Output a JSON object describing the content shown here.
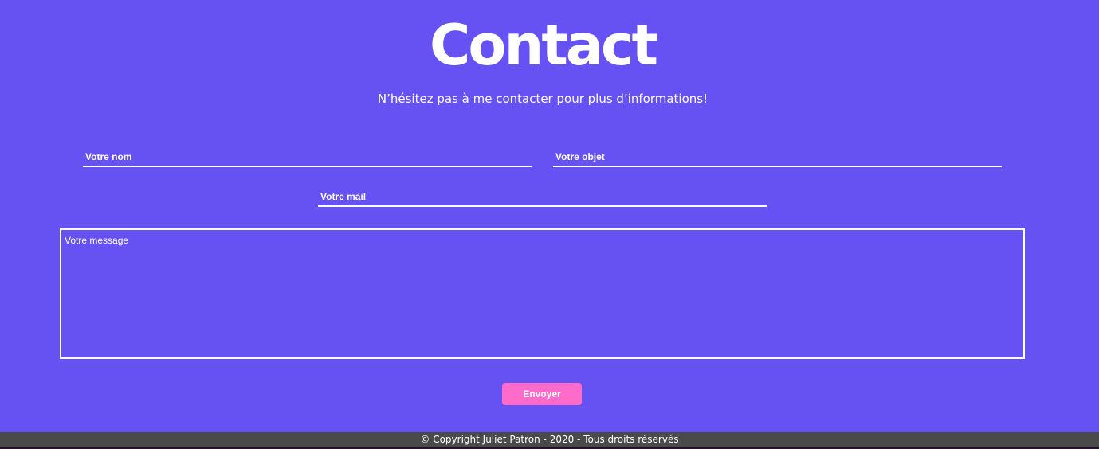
{
  "header": {
    "title": "Contact",
    "subtitle": "N’hésitez pas à me contacter pour plus d’informations!"
  },
  "form": {
    "name_placeholder": "Votre nom",
    "subject_placeholder": "Votre objet",
    "email_placeholder": "Votre mail",
    "message_placeholder": "Votre message",
    "submit_label": "Envoyer"
  },
  "footer": {
    "text": "© Copyright Juliet Patron - 2020 - Tous droits réservés"
  },
  "colors": {
    "background": "#6652f3",
    "button": "#ff6bcb",
    "footer": "#4a4a4a"
  }
}
